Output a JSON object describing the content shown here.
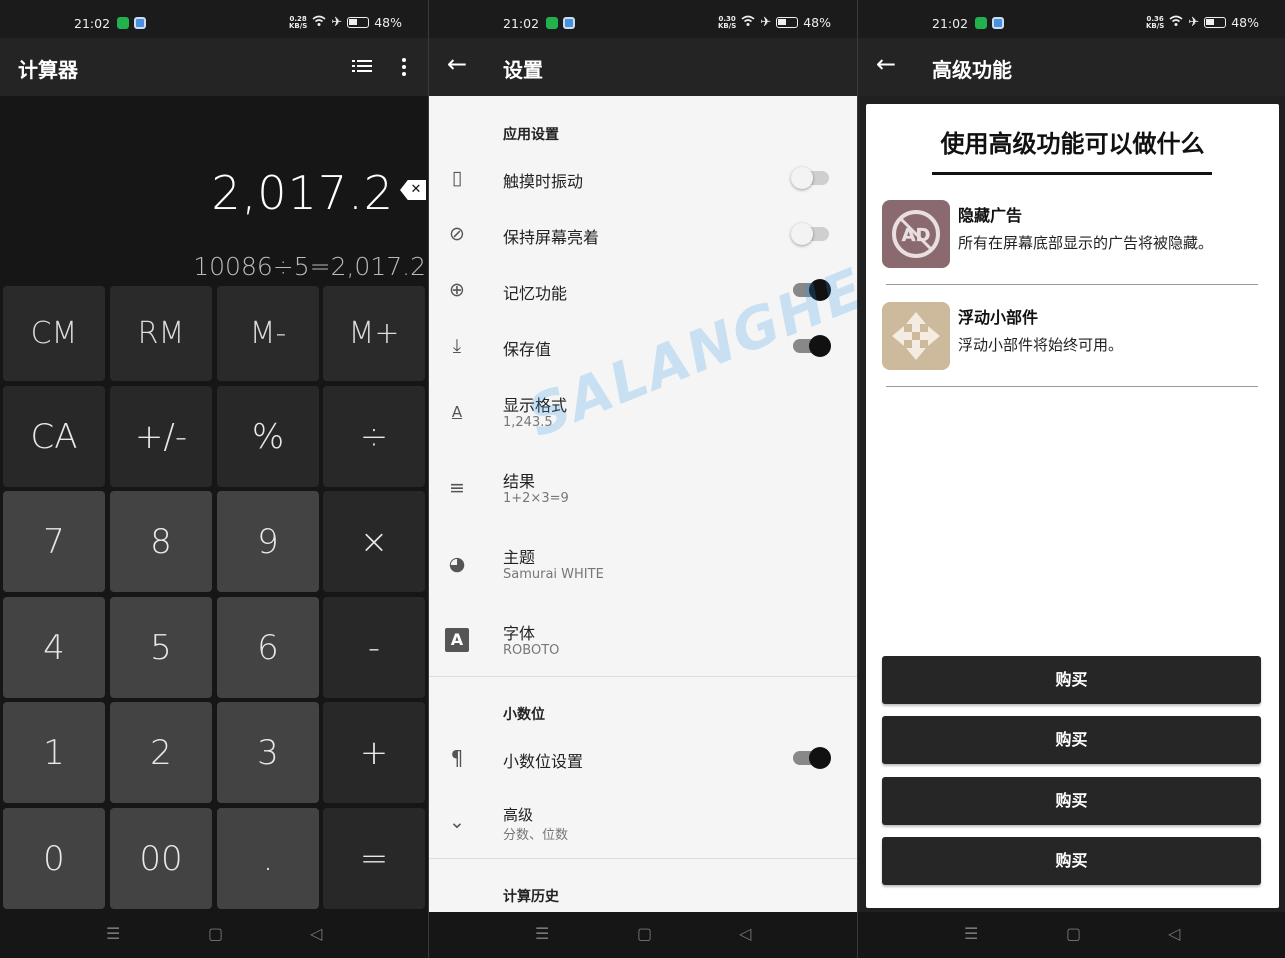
{
  "status_bars": [
    {
      "time": "21:02",
      "speed_top": "0.28",
      "speed_bottom": "KB/S",
      "battery": "48%"
    },
    {
      "time": "21:02",
      "speed_top": "0.30",
      "speed_bottom": "KB/S",
      "battery": "48%"
    },
    {
      "time": "21:02",
      "speed_top": "0.36",
      "speed_bottom": "KB/S",
      "battery": "48%"
    }
  ],
  "calculator": {
    "title": "计算器",
    "list_icon": "list-icon",
    "more_icon": "more-vert-icon",
    "display": "2,017.2",
    "expression": "10086÷5=2,017.2",
    "keys": [
      [
        "CM",
        "RM",
        "M-",
        "M+"
      ],
      [
        "CA",
        "+/-",
        "%",
        "÷"
      ],
      [
        "7",
        "8",
        "9",
        "×"
      ],
      [
        "4",
        "5",
        "6",
        "-"
      ],
      [
        "1",
        "2",
        "3",
        "+"
      ],
      [
        "0",
        "00",
        ".",
        "="
      ]
    ]
  },
  "settings": {
    "title": "设置",
    "section_app": "应用设置",
    "items": [
      {
        "label": "触摸时振动",
        "icon": "vibration-icon",
        "toggle": false
      },
      {
        "label": "保持屏幕亮着",
        "icon": "screen-off-icon",
        "toggle": false
      },
      {
        "label": "记忆功能",
        "icon": "add-circle-icon",
        "toggle": true
      },
      {
        "label": "保存值",
        "icon": "download-icon",
        "toggle": true
      },
      {
        "label": "显示格式",
        "sub": "1,243.5",
        "icon": "text-format-icon"
      },
      {
        "label": "结果",
        "sub": "1+2×3=9",
        "icon": "wrap-text-icon"
      },
      {
        "label": "主题",
        "sub": "Samurai WHITE",
        "icon": "palette-icon"
      },
      {
        "label": "字体",
        "sub": "ROBOTO",
        "icon": "font-icon"
      }
    ],
    "section_decimal": "小数位",
    "decimal_item": {
      "label": "小数位设置",
      "icon": "paragraph-icon",
      "toggle": true
    },
    "advanced_item": {
      "label": "高级",
      "sub": "分数、位数",
      "icon": "chevron-down-icon"
    },
    "section_history": "计算历史",
    "watermark": "SALANGHE"
  },
  "advanced": {
    "title": "高级功能",
    "card_title": "使用高级功能可以做什么",
    "features": [
      {
        "title": "隐藏广告",
        "desc": "所有在屏幕底部显示的广告将被隐藏。",
        "icon": "no-ads-icon",
        "icon_text": "AD"
      },
      {
        "title": "浮动小部件",
        "desc": "浮动小部件将始终可用。",
        "icon": "move-arrows-icon"
      }
    ],
    "buy_buttons": [
      "购买",
      "购买",
      "购买",
      "购买"
    ]
  },
  "nav": {
    "menu": "☰",
    "home": "▢",
    "back": "◁"
  }
}
